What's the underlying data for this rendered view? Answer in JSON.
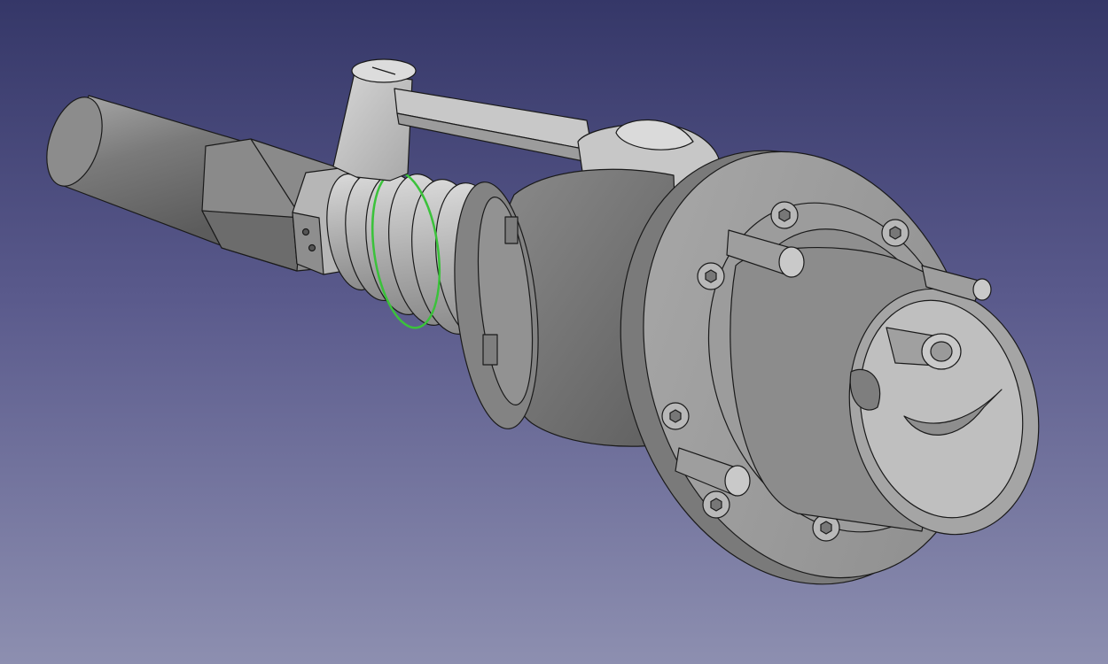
{
  "viewport": {
    "background_top": "#353768",
    "background_bottom": "#8d8fb0",
    "model_color": "#9a9a9a",
    "edge_color": "#1a1a1a",
    "selection_color": "#3bc23b"
  },
  "model": {
    "parts": [
      "grip-tube",
      "hex-nut",
      "hex-collar",
      "bellows",
      "selected-edge",
      "lever-pivot",
      "lever-arm",
      "lever-knob",
      "body-cylinder",
      "flange",
      "flange-bolts",
      "guide-pins",
      "socket",
      "center-pin"
    ]
  }
}
